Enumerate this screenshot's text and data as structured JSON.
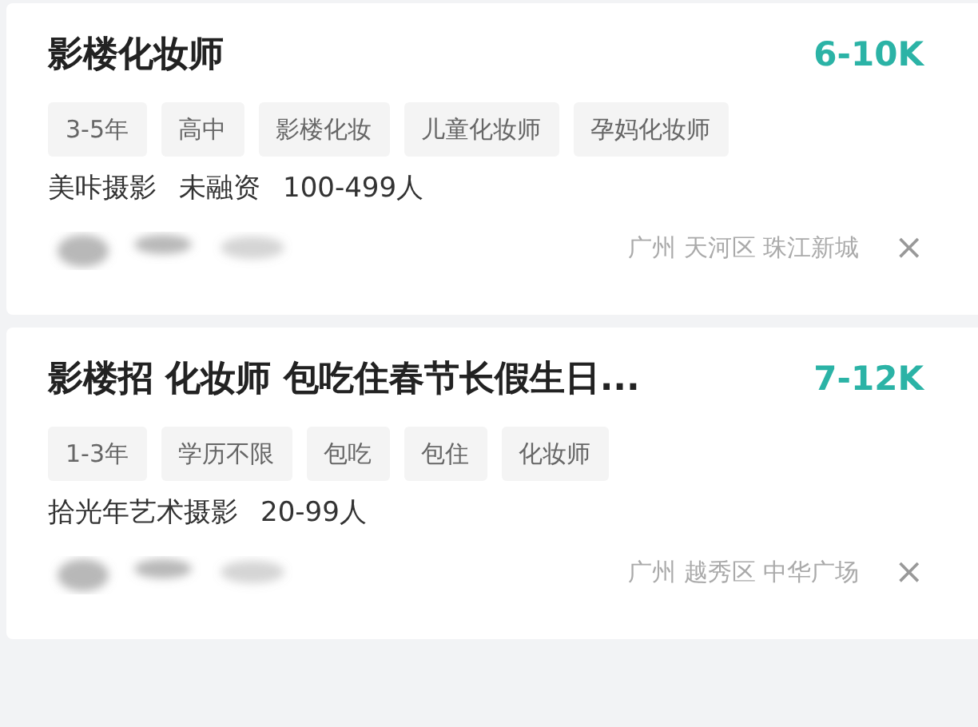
{
  "jobs": [
    {
      "title": "影楼化妆师",
      "salary": "6-10K",
      "tags": [
        "3-5年",
        "高中",
        "影楼化妆",
        "儿童化妆师",
        "孕妈化妆师"
      ],
      "company": [
        "美咔摄影",
        "未融资",
        "100-499人"
      ],
      "location": "广州 天河区 珠江新城",
      "close": "×"
    },
    {
      "title": "影楼招 化妆师 包吃住春节长假生日...",
      "salary": "7-12K",
      "tags": [
        "1-3年",
        "学历不限",
        "包吃",
        "包住",
        "化妆师"
      ],
      "company": [
        "拾光年艺术摄影",
        "20-99人"
      ],
      "location": "广州 越秀区 中华广场",
      "close": "×"
    }
  ]
}
